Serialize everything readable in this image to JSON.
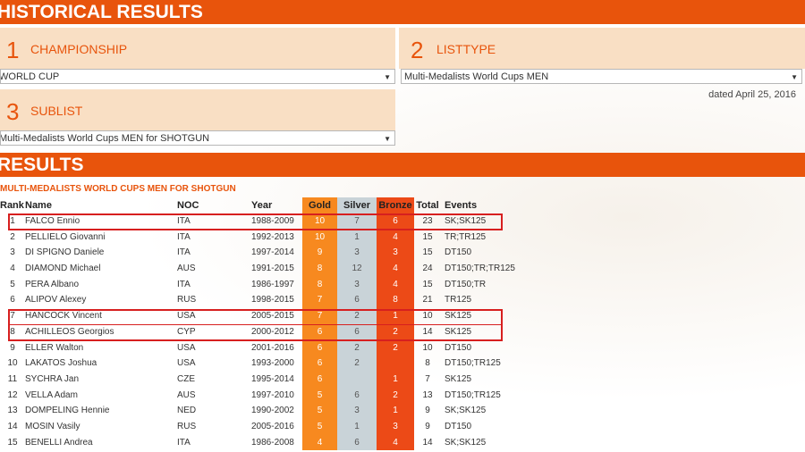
{
  "header": {
    "title": "HISTORICAL RESULTS"
  },
  "steps": [
    {
      "num": "1",
      "title": "CHAMPIONSHIP",
      "select_value": "WORLD CUP"
    },
    {
      "num": "2",
      "title": "LISTTYPE",
      "select_value": "Multi-Medalists World Cups MEN"
    },
    {
      "num": "3",
      "title": "SUBLIST",
      "select_value": "Multi-Medalists World Cups MEN for SHOTGUN"
    }
  ],
  "dated": "dated April 25, 2016",
  "results": {
    "title": "RESULTS",
    "subtitle": "MULTI-MEDALISTS WORLD CUPS MEN FOR SHOTGUN",
    "columns": [
      "Rank",
      "Name",
      "NOC",
      "Year",
      "Gold",
      "Silver",
      "Bronze",
      "Total",
      "Events"
    ],
    "rows": [
      [
        "1",
        "FALCO Ennio",
        "ITA",
        "1988-2009",
        "10",
        "7",
        "6",
        "23",
        "SK;SK125"
      ],
      [
        "2",
        "PELLIELO Giovanni",
        "ITA",
        "1992-2013",
        "10",
        "1",
        "4",
        "15",
        "TR;TR125"
      ],
      [
        "3",
        "DI SPIGNO Daniele",
        "ITA",
        "1997-2014",
        "9",
        "3",
        "3",
        "15",
        "DT150"
      ],
      [
        "4",
        "DIAMOND Michael",
        "AUS",
        "1991-2015",
        "8",
        "12",
        "4",
        "24",
        "DT150;TR;TR125"
      ],
      [
        "5",
        "PERA Albano",
        "ITA",
        "1986-1997",
        "8",
        "3",
        "4",
        "15",
        "DT150;TR"
      ],
      [
        "6",
        "ALIPOV Alexey",
        "RUS",
        "1998-2015",
        "7",
        "6",
        "8",
        "21",
        "TR125"
      ],
      [
        "7",
        "HANCOCK Vincent",
        "USA",
        "2005-2015",
        "7",
        "2",
        "1",
        "10",
        "SK125"
      ],
      [
        "8",
        "ACHILLEOS Georgios",
        "CYP",
        "2000-2012",
        "6",
        "6",
        "2",
        "14",
        "SK125"
      ],
      [
        "9",
        "ELLER Walton",
        "USA",
        "2001-2016",
        "6",
        "2",
        "2",
        "10",
        "DT150"
      ],
      [
        "10",
        "LAKATOS Joshua",
        "USA",
        "1993-2000",
        "6",
        "2",
        "",
        "8",
        "DT150;TR125"
      ],
      [
        "11",
        "SYCHRA Jan",
        "CZE",
        "1995-2014",
        "6",
        "",
        "1",
        "7",
        "SK125"
      ],
      [
        "12",
        "VELLA Adam",
        "AUS",
        "1997-2010",
        "5",
        "6",
        "2",
        "13",
        "DT150;TR125"
      ],
      [
        "13",
        "DOMPELING Hennie",
        "NED",
        "1990-2002",
        "5",
        "3",
        "1",
        "9",
        "SK;SK125"
      ],
      [
        "14",
        "MOSIN Vasily",
        "RUS",
        "2005-2016",
        "5",
        "1",
        "3",
        "9",
        "DT150"
      ],
      [
        "15",
        "BENELLI Andrea",
        "ITA",
        "1986-2008",
        "4",
        "6",
        "4",
        "14",
        "SK;SK125"
      ]
    ]
  },
  "colors": {
    "accent": "#e8540c",
    "panel": "#f9dfc4",
    "gold": "#f7891f",
    "silver": "#c9d3d8",
    "bronze": "#ec4a17",
    "highlight": "#d71f1f"
  }
}
